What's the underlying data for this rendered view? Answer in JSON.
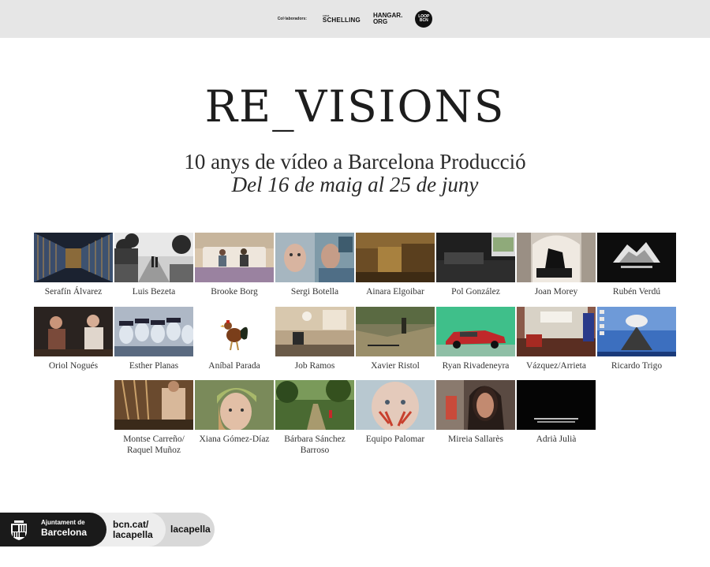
{
  "header": {
    "collab_label": "Col·laboradors:",
    "logos": {
      "schelling_small": "casa",
      "schelling_big": "SCHELLING",
      "hangar_1": "HANGAR.",
      "hangar_2": "ORG",
      "loop_1": "LOOP",
      "loop_2": "BCN"
    }
  },
  "title": "RE_VISIONS",
  "subtitle": "10 anys de vídeo a Barcelona Producció",
  "dates": "Del 16 de maig al 25 de juny",
  "artists": {
    "row1": [
      {
        "line1": "Serafín Álvarez",
        "line2": "",
        "icon": "corridor-still"
      },
      {
        "line1": "Luis Bezeta",
        "line2": "",
        "icon": "street-walk-still"
      },
      {
        "line1": "Brooke Borg",
        "line2": "",
        "icon": "sofa-room-still"
      },
      {
        "line1": "Sergi Botella",
        "line2": "",
        "icon": "faces-collage-still"
      },
      {
        "line1": "Ainara Elgoibar",
        "line2": "",
        "icon": "brown-interior-still"
      },
      {
        "line1": "Pol González",
        "line2": "",
        "icon": "dark-room-still"
      },
      {
        "line1": "Joan Morey",
        "line2": "",
        "icon": "church-figure-still"
      },
      {
        "line1": "Rubén Verdú",
        "line2": "",
        "icon": "mountain-text-still"
      }
    ],
    "row2": [
      {
        "line1": "Oriol Nogués",
        "line2": "",
        "icon": "conversation-still"
      },
      {
        "line1": "Esther Planas",
        "line2": "",
        "icon": "negative-faces-still"
      },
      {
        "line1": "Aníbal Parada",
        "line2": "",
        "icon": "rooster-still"
      },
      {
        "line1": "Job Ramos",
        "line2": "",
        "icon": "living-room-still"
      },
      {
        "line1": "Xavier Ristol",
        "line2": "",
        "icon": "hillside-still"
      },
      {
        "line1": "Ryan Rivadeneyra",
        "line2": "",
        "icon": "red-car-still"
      },
      {
        "line1": "Vázquez/Arrieta",
        "line2": "",
        "icon": "museum-room-still"
      },
      {
        "line1": "Ricardo Trigo",
        "line2": "",
        "icon": "desktop-volcano-still"
      }
    ],
    "row3": [
      {
        "line1": "Montse Carreño/",
        "line2": "Raquel Muñoz",
        "icon": "workshop-still"
      },
      {
        "line1": "Xiana Gómez-Díaz",
        "line2": "",
        "icon": "child-portrait-still"
      },
      {
        "line1": "Bárbara Sánchez",
        "line2": "Barroso",
        "icon": "forest-path-still"
      },
      {
        "line1": "Equipo Palomar",
        "line2": "",
        "icon": "painted-face-still"
      },
      {
        "line1": "Mireia Sallarès",
        "line2": "",
        "icon": "woman-portrait-still"
      },
      {
        "line1": "Adrià Julià",
        "line2": "",
        "icon": "black-subtitle-still"
      }
    ]
  },
  "footer": {
    "ajuntament_1": "Ajuntament de",
    "ajuntament_2": "Barcelona",
    "bcn_1": "bcn.cat/",
    "bcn_2": "lacapella",
    "lacapella": "lacapella"
  },
  "colors": {
    "topbar": "#e6e6e6",
    "title": "#1d1d1d",
    "footer_dark": "#1a1a1a"
  }
}
